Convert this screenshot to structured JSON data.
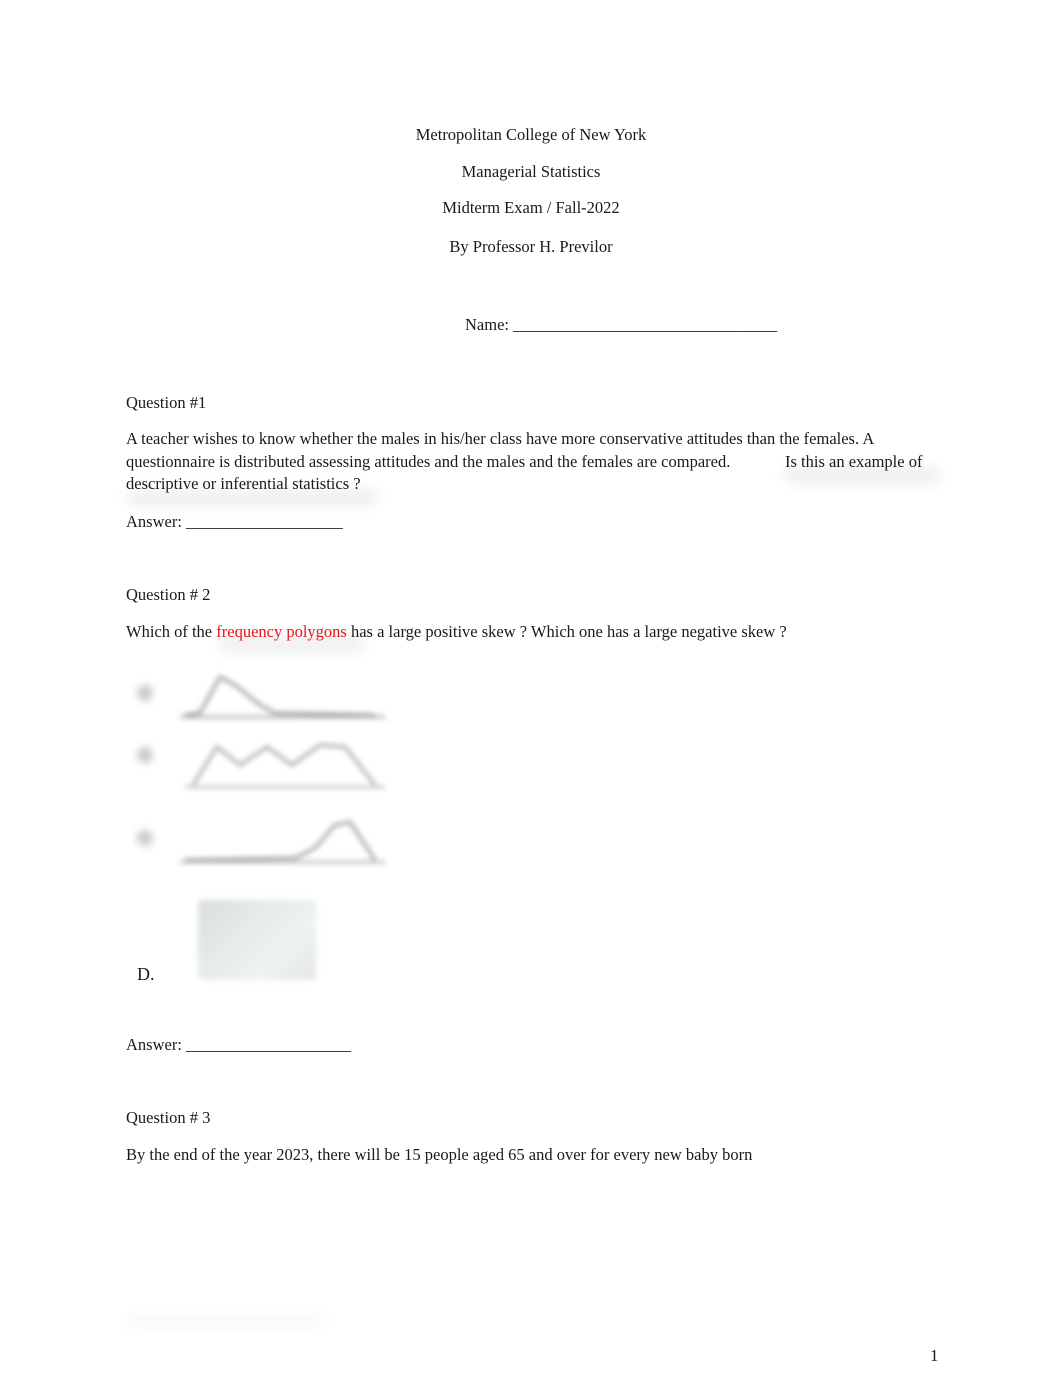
{
  "header": {
    "institution": "Metropolitan College of New York",
    "course": "Managerial Statistics",
    "exam": "Midterm Exam / Fall-2022",
    "author": "By Professor H. Previlor"
  },
  "name_field": {
    "label": "Name:",
    "blank": "________________________________"
  },
  "questions": [
    {
      "title": "Question #1",
      "text_line1": "A teacher wishes to know whether the males in his/her class have more conservative attitudes than the females. A",
      "text_line2": "questionnaire is distributed assessing attitudes and the males and the females are compared.",
      "text_line2_tail": "Is this an example of",
      "text_line3": "descriptive or inferential statistics ?",
      "answer_label": "Answer:",
      "answer_blank": "___________________"
    },
    {
      "title": "Question # 2",
      "text_before": "Which of the ",
      "text_highlight": "frequency polygons",
      "text_after": " has a large positive skew ? Which one has a large negative skew ?",
      "options": [
        {
          "label": "A.",
          "shape": "positive-skew-polygon"
        },
        {
          "label": "B.",
          "shape": "multimodal-polygon"
        },
        {
          "label": "C.",
          "shape": "negative-skew-polygon"
        },
        {
          "label": "D.",
          "shape": "blurred-image"
        }
      ],
      "answer_label": "Answer:",
      "answer_blank": "____________________"
    },
    {
      "title": "Question # 3",
      "text": "By the end of the year 2023, there will be 15 people aged 65 and over for every new baby born"
    }
  ],
  "footer": {
    "page_number": "1"
  },
  "colors": {
    "highlight": "#e8141b",
    "text": "#1a1a1a"
  }
}
